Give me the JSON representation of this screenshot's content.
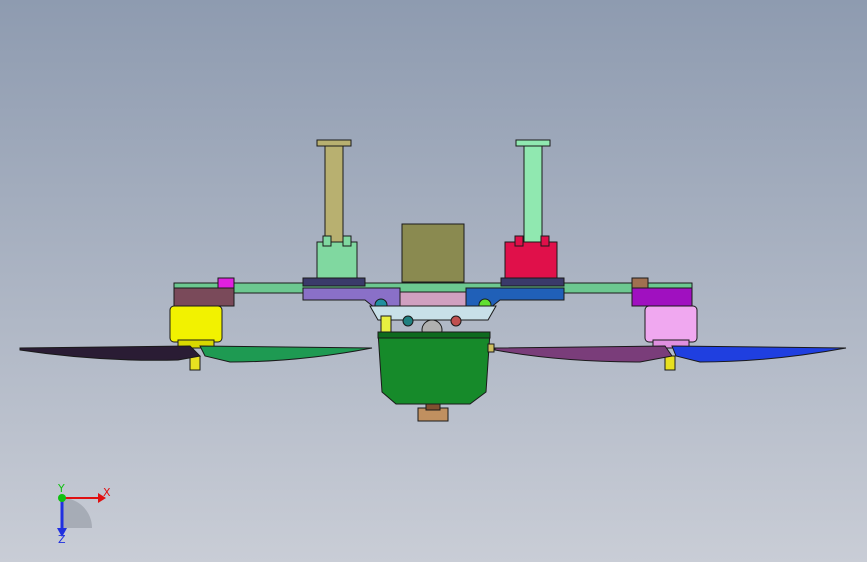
{
  "viewport": {
    "background_top": "#8e9bb0",
    "background_bottom": "#c9cdd6"
  },
  "triad": {
    "x_label": "X",
    "y_label": "Y",
    "z_label": "Z",
    "x_color": "#e01010",
    "y_color": "#10c010",
    "z_color": "#2030e0"
  },
  "parts": {
    "left_prop_dark": "#2a1c34",
    "left_prop_green": "#1e9a52",
    "right_prop_purple": "#7a3d7a",
    "right_prop_blue": "#1f3fe0",
    "left_motor": "#f2f200",
    "right_motor": "#f0a8f0",
    "left_arm_bracket": "#7a4a5a",
    "right_arm_bracket": "#a010c0",
    "left_mast": "#b8b070",
    "right_mast": "#90e8b0",
    "battery": "#8a8a50",
    "body": "#168a2a",
    "boom": "#6cc890",
    "left_plate": "#8a70c8",
    "right_plate": "#2060b8",
    "right_clamp": "#e0104a",
    "left_clamp": "#80d8a0"
  }
}
